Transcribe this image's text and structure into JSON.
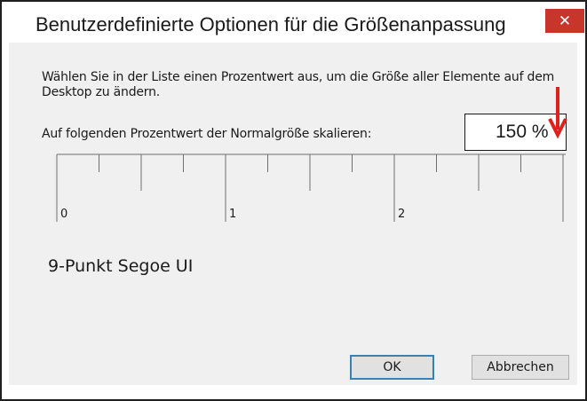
{
  "window": {
    "title": "Benutzerdefinierte Optionen für die Größenanpassung",
    "close_symbol": "✕"
  },
  "instructions": "Wählen Sie in der Liste einen Prozentwert aus, um die Größe aller Elemente auf dem Desktop zu ändern.",
  "scale_label": "Auf folgenden Prozentwert der Normalgröße skalieren:",
  "scale_value": "150 %",
  "ruler": {
    "labels": [
      "0",
      "1",
      "2"
    ]
  },
  "font_info": "9-Punkt Segoe UI",
  "buttons": {
    "ok": "OK",
    "cancel": "Abbrechen"
  },
  "colors": {
    "close_bg": "#c7352b",
    "annotation_arrow": "#e0201a",
    "ok_border": "#3c7fb1"
  },
  "icons": {
    "close": "close-icon",
    "arrow": "annotation-arrow-icon"
  }
}
